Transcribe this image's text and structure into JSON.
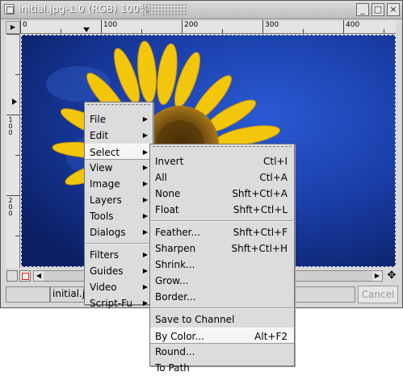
{
  "window": {
    "title": "initial.jpg-1.0 (RGB) 100%",
    "icons": {
      "window": "image-window-icon",
      "minimize": "minimize-icon",
      "maximize": "maximize-icon",
      "close": "close-icon"
    },
    "minimize_glyph": "_",
    "maximize_glyph": "□",
    "close_glyph": "×"
  },
  "rulers": {
    "horizontal_labels": [
      "0",
      "100",
      "200",
      "300",
      "400"
    ],
    "vertical_labels": [
      "1\n0\n0",
      "2\n0\n0"
    ],
    "corner_glyph": "▶"
  },
  "statusbar": {
    "filename": "initial.jpg",
    "cancel_label": "Cancel"
  },
  "scrollbar": {
    "left_arrow": "◀",
    "right_arrow": "▶",
    "navigate_glyph": "✥"
  },
  "image_menu": {
    "items": [
      {
        "label": "File",
        "submenu": true
      },
      {
        "label": "Edit",
        "submenu": true
      },
      {
        "label": "Select",
        "submenu": true,
        "active": true
      },
      {
        "label": "View",
        "submenu": true
      },
      {
        "label": "Image",
        "submenu": true
      },
      {
        "label": "Layers",
        "submenu": true
      },
      {
        "label": "Tools",
        "submenu": true
      },
      {
        "label": "Dialogs",
        "submenu": true
      },
      {
        "label": "Filters",
        "submenu": true
      },
      {
        "label": "Guides",
        "submenu": true
      },
      {
        "label": "Video",
        "submenu": true
      },
      {
        "label": "Script-Fu",
        "submenu": true
      }
    ],
    "arrow_glyph": "▶"
  },
  "select_menu": {
    "items": [
      {
        "label": "Invert",
        "accel": "Ctl+I"
      },
      {
        "label": "All",
        "accel": "Ctl+A"
      },
      {
        "label": "None",
        "accel": "Shft+Ctl+A"
      },
      {
        "label": "Float",
        "accel": "Shft+Ctl+L"
      },
      {
        "label": "Feather...",
        "accel": "Shft+Ctl+F"
      },
      {
        "label": "Sharpen",
        "accel": "Shft+Ctl+H"
      },
      {
        "label": "Shrink...",
        "accel": ""
      },
      {
        "label": "Grow...",
        "accel": ""
      },
      {
        "label": "Border...",
        "accel": ""
      },
      {
        "label": "Save to Channel",
        "accel": ""
      },
      {
        "label": "By Color...",
        "accel": "Alt+F2",
        "active": true
      },
      {
        "label": "Round...",
        "accel": ""
      },
      {
        "label": "To Path",
        "accel": ""
      }
    ]
  },
  "colors": {
    "sky": "#1a3ea8",
    "petal": "#f2c60b",
    "center": "#6b4a10"
  }
}
